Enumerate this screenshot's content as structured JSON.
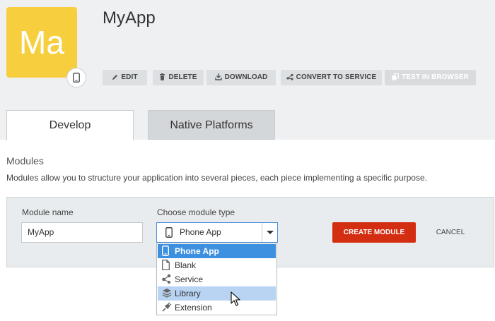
{
  "app": {
    "title": "MyApp",
    "icon_text": "Ma",
    "icon_color": "#f7cf3e"
  },
  "toolbar": {
    "edit": "EDIT",
    "delete": "DELETE",
    "download": "DOWNLOAD",
    "convert": "CONVERT TO SERVICE",
    "test": "TEST IN BROWSER"
  },
  "tabs": [
    {
      "label": "Develop",
      "active": true
    },
    {
      "label": "Native Platforms",
      "active": false
    }
  ],
  "modules": {
    "title": "Modules",
    "description": "Modules allow you to structure your application into several pieces, each piece implementing a specific purpose.",
    "name_label": "Module name",
    "name_value": "MyApp",
    "type_label": "Choose module type",
    "type_selected": "Phone App",
    "create_label": "CREATE MODULE",
    "cancel_label": "CANCEL",
    "accent_color": "#d42e12"
  },
  "dropdown": {
    "options": [
      {
        "label": "Phone App",
        "icon": "phone-icon",
        "state": "selected"
      },
      {
        "label": "Blank",
        "icon": "blank-document-icon",
        "state": ""
      },
      {
        "label": "Service",
        "icon": "service-nodes-icon",
        "state": ""
      },
      {
        "label": "Library",
        "icon": "layers-icon",
        "state": "hover"
      },
      {
        "label": "Extension",
        "icon": "plug-icon",
        "state": ""
      }
    ]
  }
}
